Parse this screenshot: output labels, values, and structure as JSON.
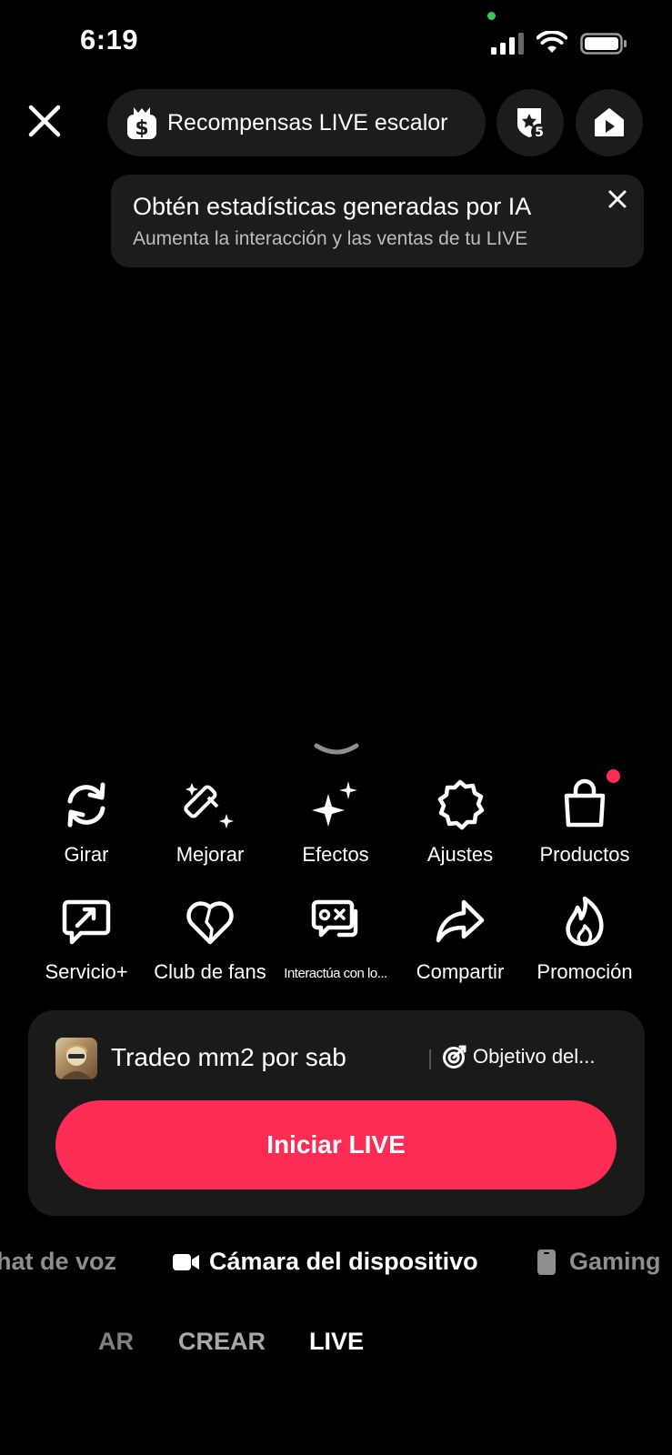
{
  "status_bar": {
    "time": "6:19"
  },
  "header": {
    "rewards_label": "Recompensas LIVE escalor",
    "rank_badge": "5"
  },
  "ai_tip": {
    "title": "Obtén estadísticas generadas por IA",
    "subtitle": "Aumenta la interacción y las ventas de tu LIVE"
  },
  "tools": {
    "row1": [
      {
        "label": "Girar",
        "icon": "rotate-icon"
      },
      {
        "label": "Mejorar",
        "icon": "magic-wand-icon"
      },
      {
        "label": "Efectos",
        "icon": "sparkle-icon"
      },
      {
        "label": "Ajustes",
        "icon": "gear-icon"
      },
      {
        "label": "Productos",
        "icon": "shopping-bag-icon"
      }
    ],
    "row2": [
      {
        "label": "Servicio+",
        "icon": "service-icon"
      },
      {
        "label": "Club de fans",
        "icon": "heart-icon"
      },
      {
        "label": "Interactúa con lo...",
        "icon": "game-chat-icon"
      },
      {
        "label": "Compartir",
        "icon": "share-arrow-icon"
      },
      {
        "label": "Promoción",
        "icon": "flame-icon"
      }
    ]
  },
  "panel": {
    "live_title": "Tradeo mm2 por sab",
    "goal_label": "Objetivo del...",
    "start_button": "Iniciar LIVE"
  },
  "source_tabs": {
    "voice": "hat de voz",
    "camera": "Cámara del dispositivo",
    "gaming": "Gaming"
  },
  "mode_tabs": {
    "prev": "AR",
    "create": "CREAR",
    "live": "LIVE"
  },
  "colors": {
    "accent": "#fe2c55",
    "surface": "#1c1c1e",
    "background": "#000000"
  }
}
